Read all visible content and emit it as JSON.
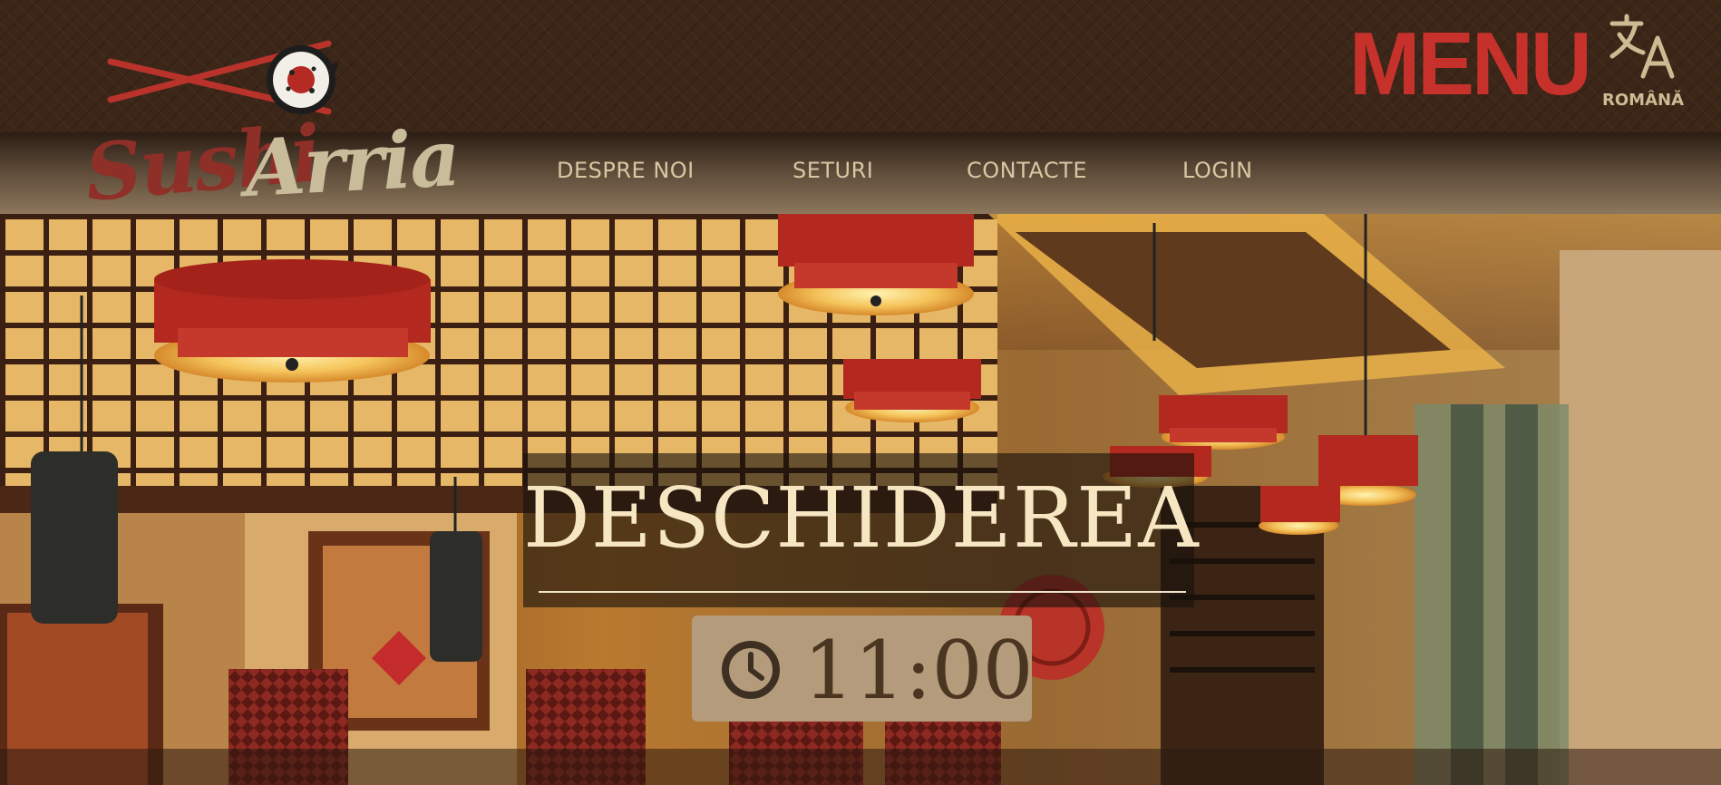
{
  "header": {
    "brand": {
      "word1": "Sushi",
      "word2": "Arria"
    },
    "menu_label": "MENU",
    "language": {
      "label": "ROMÂNĂ",
      "icon": "translate-icon"
    }
  },
  "nav": {
    "items": [
      {
        "label": "DESPRE NOI"
      },
      {
        "label": "SETURI"
      },
      {
        "label": "CONTACTE"
      },
      {
        "label": "LOGIN"
      }
    ]
  },
  "hero": {
    "opening_title": "DESCHIDEREA",
    "opening_time": "11:00",
    "time_icon": "clock-icon"
  },
  "colors": {
    "brand_red": "#c7312b",
    "nav_text": "#d8c7a2",
    "title_cream": "#f6e6c2",
    "time_box": "#b39b7b"
  }
}
